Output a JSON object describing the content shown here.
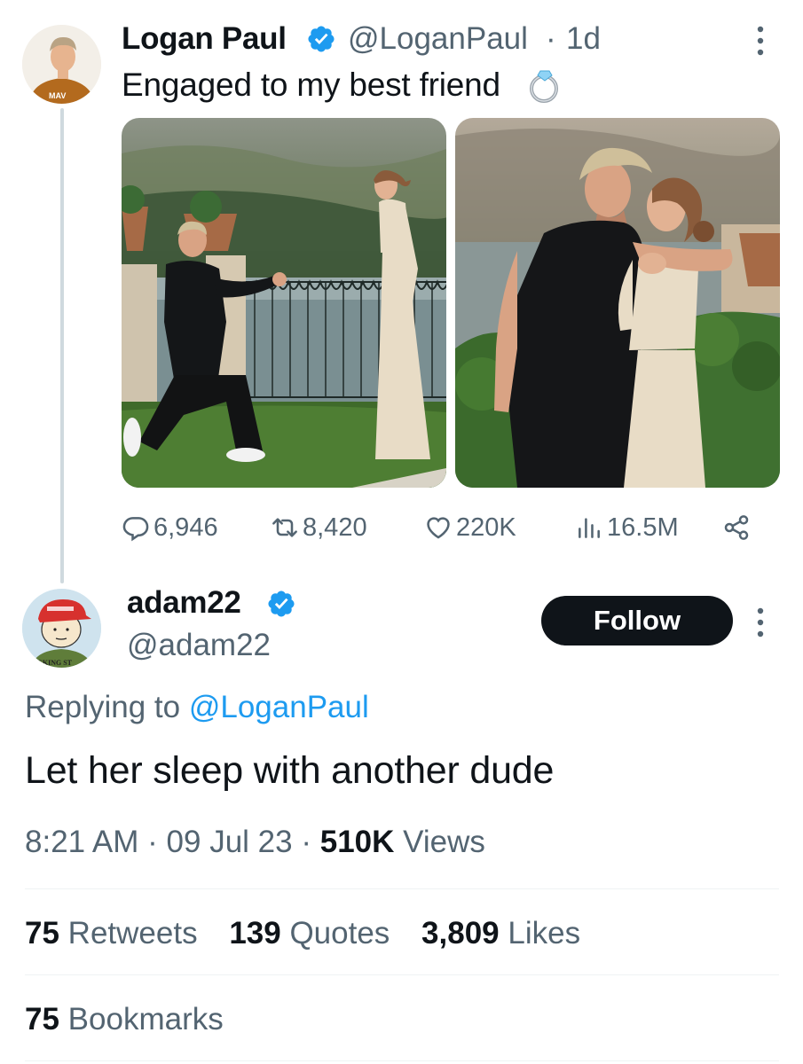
{
  "colors": {
    "accent": "#1d9bf0",
    "text_primary": "#0f1419",
    "text_secondary": "#536471",
    "divider": "#eff3f4",
    "thread_line": "#cfd9de",
    "follow_bg": "#0f1419"
  },
  "original_tweet": {
    "display_name": "Logan Paul",
    "handle": "@LoganPaul",
    "separator": "·",
    "time": "1d",
    "text": "Engaged to my best friend",
    "text_emoji": "ring-emoji",
    "verified_icon": "verified-badge-icon",
    "avatar_text": "MAV",
    "media": [
      {
        "alt": "photo-proposal-icon"
      },
      {
        "alt": "photo-kiss-icon"
      }
    ],
    "actions": {
      "replies": "6,946",
      "retweets": "8,420",
      "likes": "220K",
      "views": "16.5M",
      "reply_icon": "reply-icon",
      "retweet_icon": "retweet-icon",
      "like_icon": "heart-icon",
      "views_icon": "views-chart-icon",
      "share_icon": "share-icon"
    }
  },
  "reply_tweet": {
    "display_name": "adam22",
    "handle": "@adam22",
    "follow_label": "Follow",
    "avatar_text": "ICKING ST",
    "replying_prefix": "Replying to",
    "replying_handle": "@LoganPaul",
    "text": "Let her sleep with another dude",
    "time": "8:21 AM",
    "date": "09 Jul 23",
    "views_count": "510K",
    "views_label": "Views",
    "stats": {
      "retweets_count": "75",
      "retweets_label": "Retweets",
      "quotes_count": "139",
      "quotes_label": "Quotes",
      "likes_count": "3,809",
      "likes_label": "Likes",
      "bookmarks_count": "75",
      "bookmarks_label": "Bookmarks"
    }
  }
}
